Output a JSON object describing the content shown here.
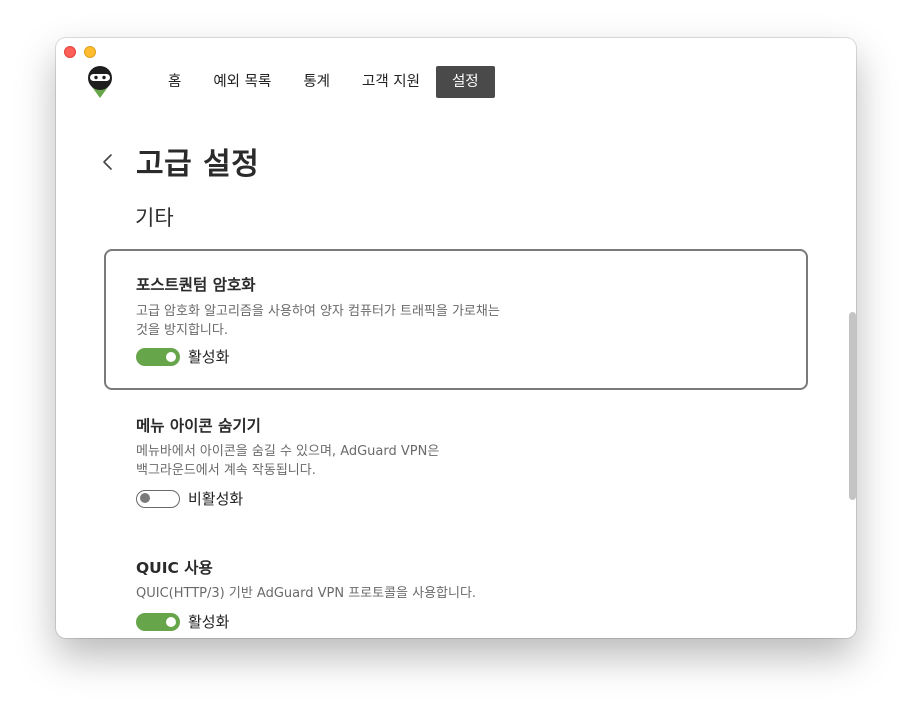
{
  "window": {
    "colors": {
      "close": "#fe5f57",
      "minimize": "#febc2e"
    }
  },
  "logo": {
    "icon": "adguard-ninja-logo-icon"
  },
  "nav": {
    "items": [
      {
        "label": "홈"
      },
      {
        "label": "예외 목록"
      },
      {
        "label": "통계"
      },
      {
        "label": "고객 지원"
      },
      {
        "label": "설정"
      }
    ],
    "active_index": 4
  },
  "page": {
    "title": "고급 설정",
    "back_icon": "chevron-left-icon",
    "section_title": "기타"
  },
  "settings": [
    {
      "title": "포스트퀀텀 암호화",
      "description_line1": "고급 암호화 알고리즘을 사용하여 양자 컴퓨터가 트래픽을 가로채는",
      "description_line2": "것을 방지합니다.",
      "state_label": "활성화",
      "enabled": true
    },
    {
      "title": "메뉴 아이콘 숨기기",
      "description_line1": "메뉴바에서 아이콘을 숨길 수 있으며, AdGuard VPN은",
      "description_line2": "백그라운드에서 계속 작동됩니다.",
      "state_label": "비활성화",
      "enabled": false
    },
    {
      "title": "QUIC 사용",
      "description_line1": "QUIC(HTTP/3) 기반 AdGuard VPN 프로토콜을 사용합니다.",
      "state_label": "활성화",
      "enabled": true
    }
  ],
  "colors": {
    "toggle_on": "#67a54b",
    "active_tab": "#4a4a4a",
    "highlight_border": "#7a7a7a"
  }
}
